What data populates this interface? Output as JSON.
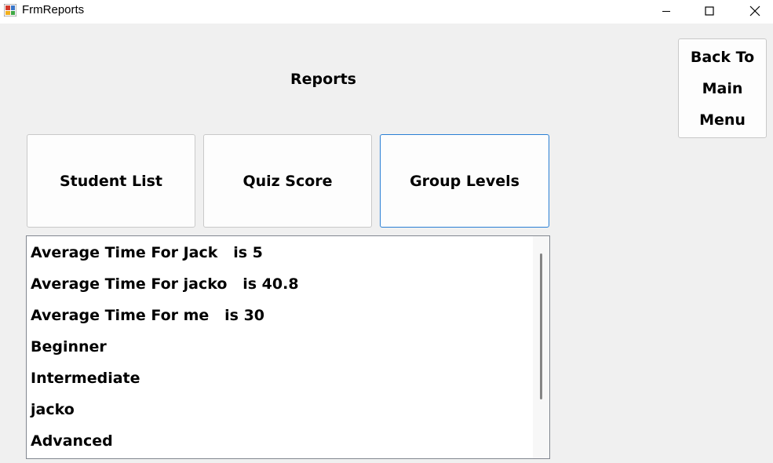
{
  "window": {
    "title": "FrmReports",
    "icon": "windows-forms-app-icon",
    "controls": [
      "minimize-icon",
      "maximize-icon",
      "close-icon"
    ]
  },
  "heading": "Reports",
  "buttons": {
    "student_list": "Student List",
    "quiz_score": "Quiz Score",
    "group_levels": "Group Levels",
    "back_line1": "Back To",
    "back_line2": "Main",
    "back_line3": "Menu"
  },
  "list": {
    "items": [
      "Average Time For Jack   is 5",
      "Average Time For jacko   is 40.8",
      "Average Time For me   is 30",
      "Beginner",
      "Intermediate",
      "jacko",
      "Advanced"
    ]
  },
  "colors": {
    "background": "#f0f0f0",
    "focus_border": "#2a7fd4"
  }
}
